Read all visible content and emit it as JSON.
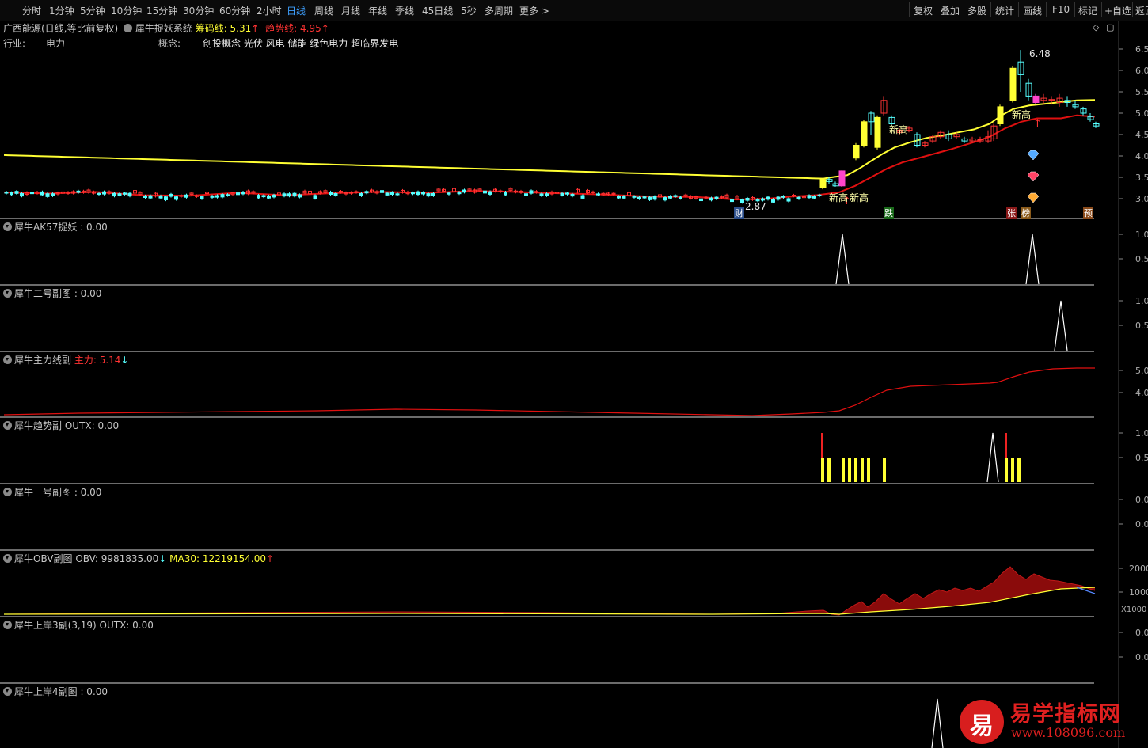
{
  "toolbar": {
    "periods": [
      "分时",
      "1分钟",
      "5分钟",
      "10分钟",
      "15分钟",
      "30分钟",
      "60分钟",
      "2小时",
      "日线",
      "周线",
      "月线",
      "年线",
      "季线",
      "45日线",
      "5秒",
      "多周期",
      "更多 >"
    ],
    "active_period": "日线",
    "actions": [
      "复权",
      "叠加",
      "多股",
      "统计",
      "画线",
      "F10",
      "标记",
      "+自选",
      "返回"
    ]
  },
  "stock": {
    "name_line": "广西能源(日线,等比前复权)",
    "system_name": "犀牛捉妖系统",
    "chip_label": "筹码线: 5.31",
    "trend_label": "趋势线: 4.95",
    "industry_label": "行业:",
    "industry_value": "电力",
    "concept_label": "概念:",
    "concept_value": "创投概念 光伏 风电 储能 绿色电力 超临界发电",
    "high_price": "6.48",
    "low_price": "2.87",
    "new_high_1": "新高",
    "new_high_2": "新高",
    "new_high_3": "新高",
    "new_high_4": "新高",
    "tag_cai": "财",
    "tag_die": "跌",
    "tag_zhang": "张",
    "tag_bang": "榜",
    "tag_yu": "预",
    "main_axis": [
      "6.5",
      "6.0",
      "5.5",
      "5.0",
      "4.5",
      "4.0",
      "3.5",
      "3.0"
    ]
  },
  "panels": [
    {
      "title": "犀牛AK57捉妖 : 0.00",
      "axis": [
        "1.0",
        "0.5"
      ]
    },
    {
      "title": "犀牛二号副图 : 0.00",
      "axis": [
        "1.0",
        "0.5"
      ]
    },
    {
      "title": "犀牛主力线副",
      "value_label": "主力: 5.14",
      "axis": [
        "5.0",
        "4.0"
      ]
    },
    {
      "title": "犀牛趋势副  OUTX: 0.00",
      "axis": [
        "1.0",
        "0.5"
      ]
    },
    {
      "title": "犀牛一号副图 : 0.00",
      "axis": [
        "0.0",
        "0.0"
      ]
    },
    {
      "title": "犀牛OBV副图  OBV: 9981835.00",
      "ma_label": "MA30: 12219154.00",
      "axis": [
        "2000",
        "1000",
        "X1000"
      ]
    },
    {
      "title": "犀牛上岸3副(3,19)  OUTX: 0.00",
      "axis": [
        "0.0",
        "0.0"
      ]
    },
    {
      "title": "犀牛上岸4副图 : 0.00",
      "axis": []
    }
  ],
  "watermark": {
    "logo_char": "易",
    "name": "易学指标网",
    "url": "www.108096.com"
  },
  "colors": {
    "up": "#ff3333",
    "down": "#55ffff",
    "yellow": "#ffff33",
    "trend": "#e01010",
    "active": "#3ea0ff"
  }
}
